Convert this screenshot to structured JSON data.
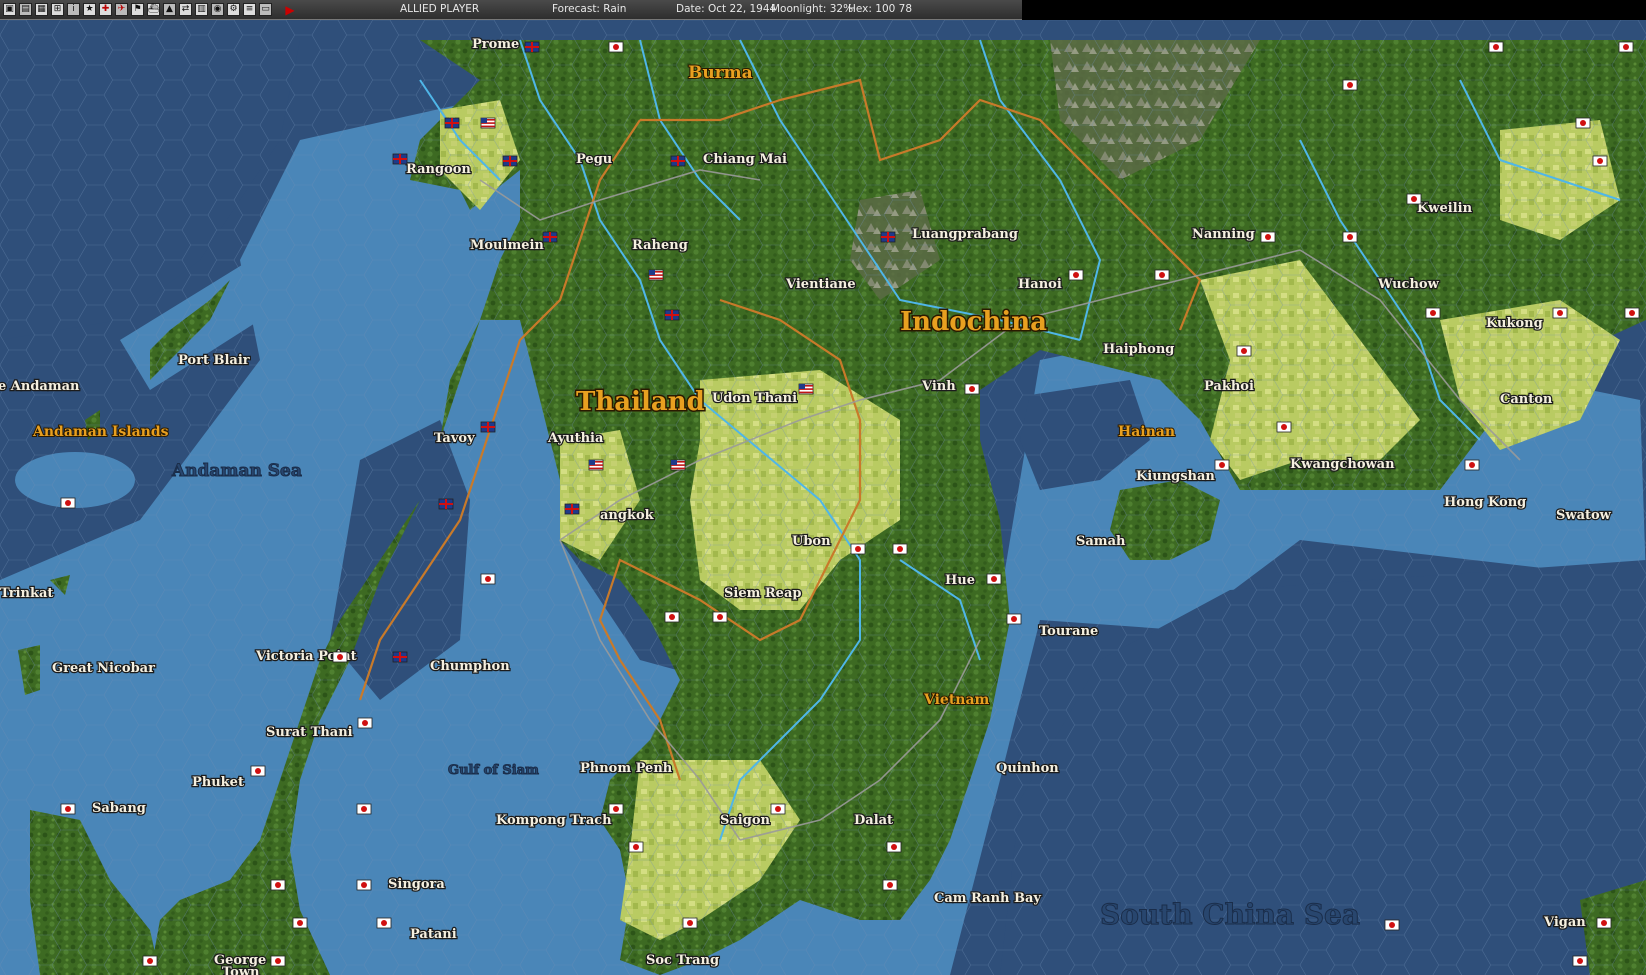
{
  "topbar": {
    "side": "ALLIED PLAYER",
    "forecast": "Forecast: Rain",
    "date": "Date: Oct 22, 1944",
    "moonlight": "Moonlight: 32%",
    "hex": "Hex: 100 78"
  },
  "toolbar_icons": [
    "map-icon",
    "report-icon",
    "intel-icon",
    "air-icon",
    "info-icon",
    "star-icon",
    "ground-icon",
    "air-unit-icon",
    "flag-icon",
    "ship-icon",
    "base-icon",
    "transport-icon",
    "supply-icon",
    "globe-icon",
    "gear-icon",
    "list-icon",
    "save-icon"
  ],
  "colors": {
    "deep_sea": "#2f4f7a",
    "shallow_sea": "#4a86b8",
    "land": "#3e6a22",
    "clear": "#c9d77a",
    "river": "#4fb6e8",
    "border": "#c87a2a",
    "road": "#9a9a9a"
  },
  "map": {
    "regions": {
      "burma": "Burma",
      "indochina": "Indochina",
      "thailand": "Thailand",
      "vietnam": "Vietnam",
      "hainan": "Hainan",
      "andaman_islands": "Andaman Islands"
    },
    "seas": {
      "andaman_sea": "Andaman Sea",
      "gulf_of_siam": "Gulf of Siam",
      "south_china_sea": "South China Sea"
    },
    "cities": {
      "prome": "Prome",
      "rangoon": "Rangoon",
      "pegu": "Pegu",
      "moulmein": "Moulmein",
      "chiang_mai": "Chiang Mai",
      "raheng": "Raheng",
      "luangprabang": "Luangprabang",
      "nanning": "Nanning",
      "kweilin": "Kweilin",
      "vientiane": "Vientiane",
      "hanoi": "Hanoi",
      "wuchow": "Wuchow",
      "haiphong": "Haiphong",
      "kukong": "Kukong",
      "port_blair": "Port Blair",
      "andaman": "e Andaman",
      "udon_thani": "Udon Thani",
      "vinh": "Vinh",
      "pakhoi": "Pakhoi",
      "canton": "Canton",
      "tavoy": "Tavoy",
      "ayuthia": "Ayuthia",
      "kwangchowan": "Kwangchowan",
      "kiungshan": "Kiungshan",
      "hong_kong": "Hong Kong",
      "bangkok": "angkok",
      "ubon": "Ubon",
      "swatow": "Swatow",
      "samah": "Samah",
      "hue": "Hue",
      "trinkat": "Trinkat",
      "siem_reap": "Siem Reap",
      "tourane": "Tourane",
      "victoria_point": "Victoria Point",
      "chumphon": "Chumphon",
      "great_nicobar": "Great Nicobar",
      "surat_thani": "Surat Thani",
      "quinhon": "Quinhon",
      "phnom_penh": "Phnom Penh",
      "phuket": "Phuket",
      "sabang": "Sabang",
      "kompong_trach": "Kompong Trach",
      "saigon": "Saigon",
      "dalat": "Dalat",
      "singora": "Singora",
      "cam_ranh_bay": "Cam Ranh Bay",
      "patani": "Patani",
      "vigan": "Vigan",
      "george_town_1": "George",
      "george_town_2": "Town",
      "soc_trang": "Soc Trang"
    }
  }
}
